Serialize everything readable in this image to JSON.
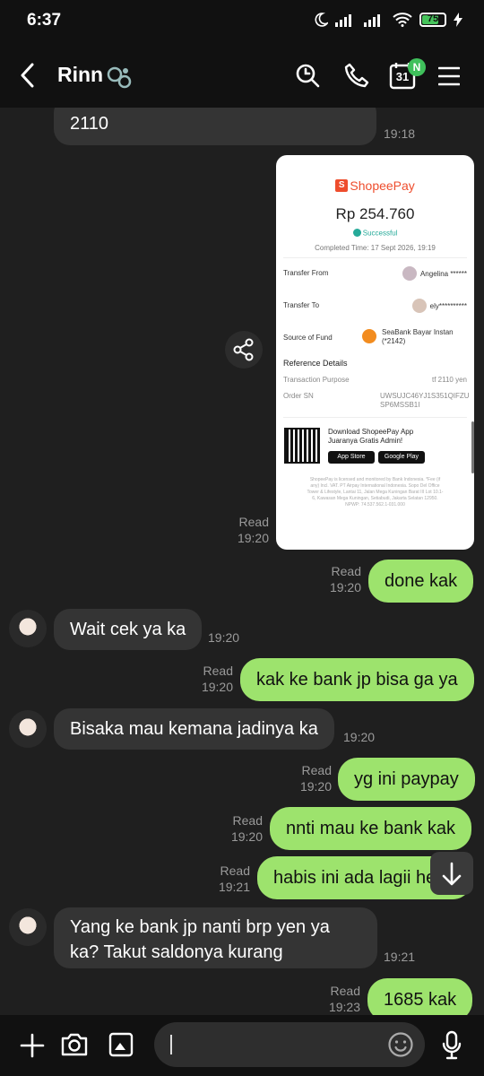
{
  "status": {
    "time": "6:37",
    "battery": "75",
    "battery_level": 0.75
  },
  "header": {
    "title": "Rinn",
    "calendar_day": "31",
    "calendar_badge": "N"
  },
  "messages": [
    {
      "dir": "in",
      "text": "2110",
      "time": "19:18"
    },
    {
      "dir": "out-image",
      "read": "Read",
      "time": "19:20"
    },
    {
      "dir": "out",
      "text": "done kak",
      "read": "Read",
      "time": "19:20"
    },
    {
      "dir": "in",
      "text": "Wait cek ya ka",
      "time": "19:20"
    },
    {
      "dir": "out",
      "text": "kak ke bank jp bisa ga ya",
      "read": "Read",
      "time": "19:20"
    },
    {
      "dir": "in",
      "text": "Bisaka mau kemana jadinya ka",
      "time": "19:20"
    },
    {
      "dir": "out",
      "text": "yg ini paypay",
      "read": "Read",
      "time": "19:20"
    },
    {
      "dir": "out",
      "text": "nnti mau ke bank kak",
      "read": "Read",
      "time": "19:20"
    },
    {
      "dir": "out",
      "text": "habis ini ada lagii hehe",
      "read": "Read",
      "time": "19:21"
    },
    {
      "dir": "in",
      "text": "Yang ke bank jp nanti brp yen ya ka? Takut saldonya kurang",
      "time": "19:21"
    },
    {
      "dir": "out",
      "text": "1685 kak",
      "read": "Read",
      "time": "19:23"
    }
  ],
  "receipt": {
    "brand": "ShopeePay",
    "amount": "Rp 254.760",
    "status": "Successful",
    "completed": "Completed Time: 17 Sept 2026, 19:19",
    "from_label": "Transfer From",
    "from_value": "Angelina ******",
    "to_label": "Transfer To",
    "to_value": "ely**********",
    "fund_label": "Source of Fund",
    "fund_value": "SeaBank Bayar Instan (*2142)",
    "ref_title": "Reference Details",
    "purpose_label": "Transaction Purpose",
    "purpose_value": "tf 2110 yen",
    "order_label": "Order SN",
    "order_value": "UWSUJC46YJ1S351QIFZU SP6MSSB1I",
    "download_title": "Download ShopeePay App",
    "download_sub": "Juaranya Gratis Admin!",
    "appstore": "App Store",
    "googleplay": "Google Play",
    "footer": "ShopeePay is licensed and monitored by Bank Indonesia. *Fee (if any) Incl. VAT. PT Airpay International Indonesia. Sopo Del Office Tower & Lifestyle, Lantai 11, Jalan Mega Kuningan Barat III Lot 10.1-6, Kawasan Mega Kuningan, Setiabudi, Jakarta Selatan 12950. NPWP: 74.537.562.1-031.000"
  },
  "colors": {
    "out_bubble": "#9de36d",
    "in_bubble": "#343434",
    "background": "#1f1f1f",
    "shopee": "#ee4d2d"
  }
}
